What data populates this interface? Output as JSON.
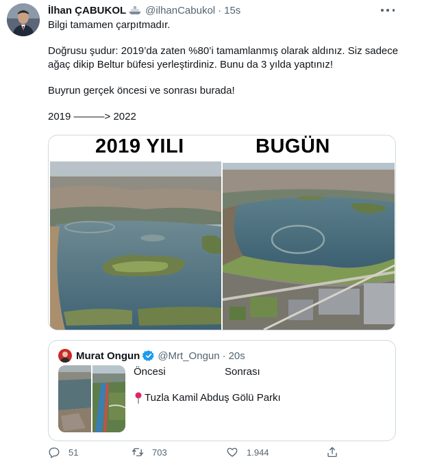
{
  "author": {
    "display_name": "İlhan ÇABUKOL",
    "handle": "@ilhanCabukol",
    "separator": "·",
    "time": "15s",
    "badge_icon": "ship-emoji-icon"
  },
  "tweet": {
    "paragraphs": [
      "Bilgi tamamen çarpıtmadır.",
      "Doğrusu şudur: 2019’da zaten %80’i tamamlanmış olarak aldınız. Siz sadece ağaç dikip Beltur büfesi yerleştirdiniz. Bunu da 3 yılda yaptınız!",
      "Buyrun gerçek öncesi ve sonrası burada!",
      "2019 ———> 2022"
    ]
  },
  "media": {
    "left_label": "2019 YILI",
    "right_label": "BUGÜN"
  },
  "quote": {
    "display_name": "Murat Ongun",
    "handle": "@Mrt_Ongun",
    "separator": "·",
    "time": "20s",
    "once": "Öncesi",
    "sonra": "Sonrası",
    "location": "Tuzla Kamil Abduş Gölü Parkı"
  },
  "actions": {
    "replies": "51",
    "retweets": "703",
    "likes": "1.944"
  },
  "colors": {
    "text": "#0f1419",
    "secondary": "#536471",
    "border": "#cfd9de",
    "verified": "#1d9bf0"
  }
}
